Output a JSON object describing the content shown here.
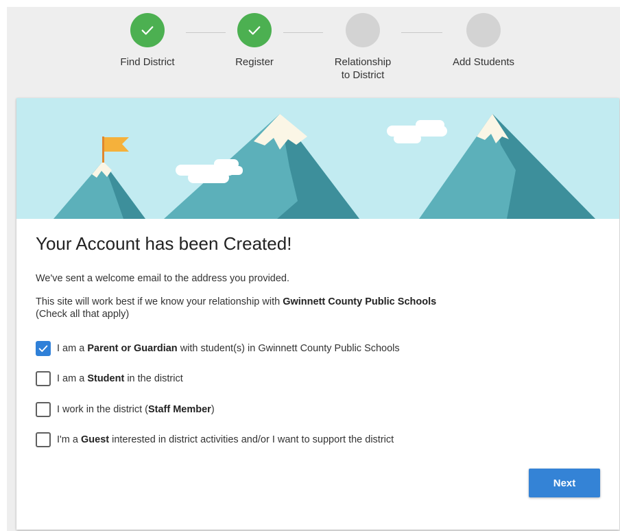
{
  "stepper": {
    "steps": [
      {
        "label": "Find District",
        "completed": true
      },
      {
        "label": "Register",
        "completed": true
      },
      {
        "label": "Relationship to District",
        "completed": false
      },
      {
        "label": "Add Students",
        "completed": false
      }
    ]
  },
  "card": {
    "title": "Your Account has been Created!",
    "welcome_text": "We've sent a welcome email to the address you provided.",
    "relationship_prefix": "This site will work best if we know your relationship with ",
    "district_name": "Gwinnett County Public Schools",
    "check_all": "(Check all that apply)",
    "options": [
      {
        "checked": true,
        "prefix": "I am a ",
        "bold": "Parent or Guardian",
        "suffix": " with student(s) in Gwinnett County Public Schools"
      },
      {
        "checked": false,
        "prefix": "I am a ",
        "bold": "Student",
        "suffix": " in the district"
      },
      {
        "checked": false,
        "prefix": "I work in the district (",
        "bold": "Staff Member",
        "suffix": ")"
      },
      {
        "checked": false,
        "prefix": "I'm a ",
        "bold": "Guest",
        "suffix": " interested in district activities and/or I want to support the district"
      }
    ],
    "next_label": "Next"
  },
  "colors": {
    "step_complete": "#4cb051",
    "step_pending": "#d3d3d3",
    "banner_sky": "#c2ebf1",
    "mountain_light": "#5cb0ba",
    "mountain_dark": "#3d8f9b",
    "snow": "#fbf6e6",
    "flag": "#f5b13b",
    "checkbox_checked": "#2f80d8",
    "button": "#3483d6"
  }
}
